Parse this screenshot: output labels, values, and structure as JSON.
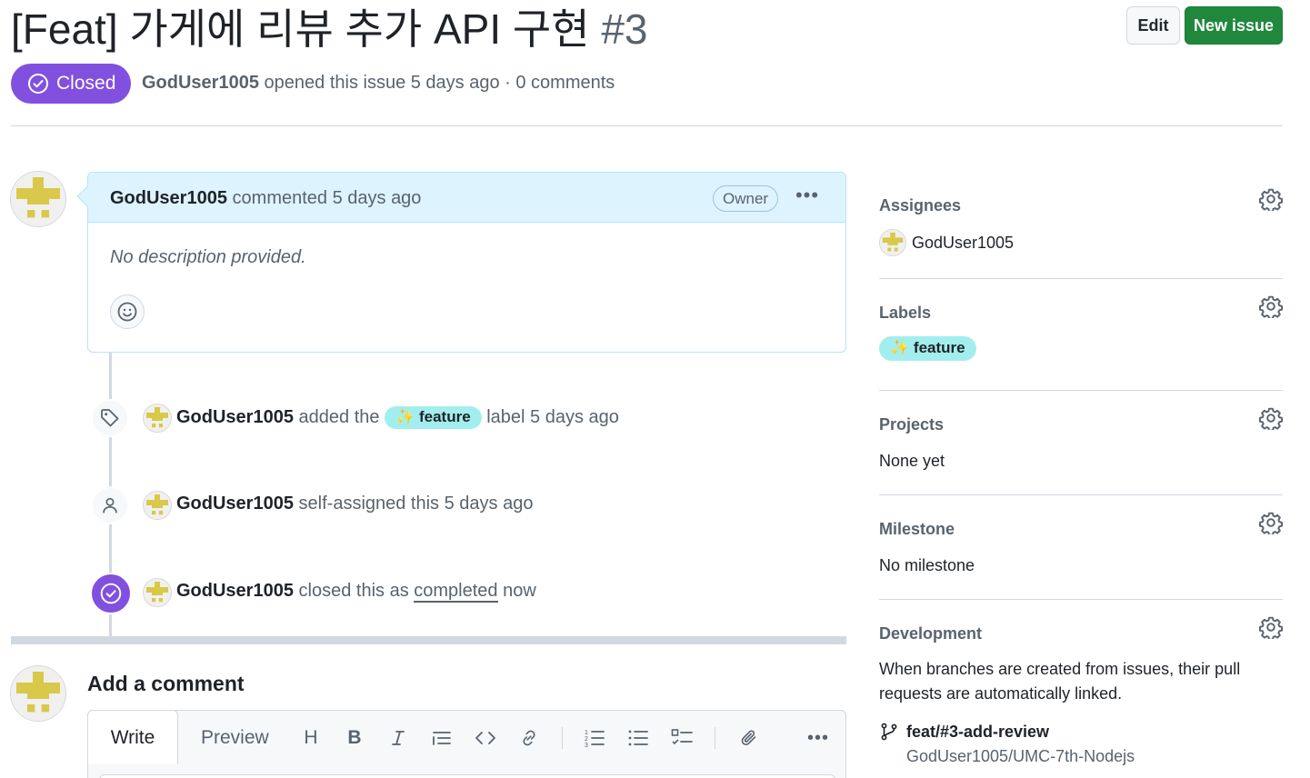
{
  "issue": {
    "title": "[Feat] 가게에 리뷰 추가 API 구현",
    "number": "#3",
    "status": "Closed",
    "author": "GodUser1005",
    "meta_rest": "opened this issue 5 days ago · 0 comments"
  },
  "header": {
    "edit_label": "Edit",
    "new_issue_label": "New issue"
  },
  "comment": {
    "author": "GodUser1005",
    "action": "commented 5 days ago",
    "role_badge": "Owner",
    "body": "No description provided."
  },
  "timeline": [
    {
      "actor": "GodUser1005",
      "pre": "added the",
      "label": "feature",
      "label_emoji": "✨",
      "post": "label 5 days ago",
      "icon": "tag-icon"
    },
    {
      "actor": "GodUser1005",
      "text": "self-assigned this 5 days ago",
      "icon": "person-icon"
    },
    {
      "actor": "GodUser1005",
      "pre": "closed this as",
      "link": "completed",
      "post": "now",
      "icon": "check-circle-icon"
    }
  ],
  "add_comment": {
    "title": "Add a comment",
    "tab_write": "Write",
    "tab_preview": "Preview",
    "tools": [
      "heading-icon",
      "bold-icon",
      "italic-icon",
      "quote-icon",
      "code-icon",
      "link-icon",
      "ordered-list-icon",
      "unordered-list-icon",
      "task-list-icon",
      "attach-icon",
      "more-icon"
    ]
  },
  "sidebar": {
    "assignees": {
      "heading": "Assignees",
      "user": "GodUser1005"
    },
    "labels": {
      "heading": "Labels",
      "label": "feature",
      "label_emoji": "✨"
    },
    "projects": {
      "heading": "Projects",
      "value": "None yet"
    },
    "milestone": {
      "heading": "Milestone",
      "value": "No milestone"
    },
    "development": {
      "heading": "Development",
      "description": "When branches are created from issues, their pull requests are automatically linked.",
      "branch": "feat/#3-add-review",
      "repo": "GodUser1005/UMC-7th-Nodejs"
    }
  },
  "colors": {
    "closed": "#8250df",
    "label": "#a2eeef",
    "new_issue": "#1f883d",
    "comment_header": "#ddf4ff"
  }
}
